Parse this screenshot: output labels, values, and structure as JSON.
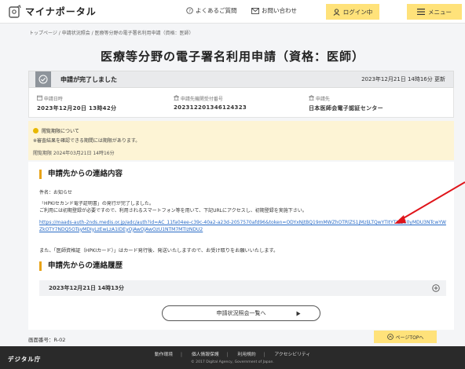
{
  "header": {
    "logo_text": "マイナポータル",
    "faq_label": "よくあるご質問",
    "contact_label": "お問い合わせ",
    "login_label": "ログイン中",
    "menu_label": "メニュー"
  },
  "breadcrumb": "トップページ / 申請状況照会 / 医療等分野の電子署名利用申請（資格：医師）",
  "page_title": "医療等分野の電子署名利用申請（資格：医師）",
  "status": {
    "message": "申請が完了しました",
    "updated": "2023年12月21日 14時16分 更新"
  },
  "info": {
    "applied_label": "申請日時",
    "applied_value": "2023年12月20日 13時42分",
    "receipt_label": "申請先機関受付番号",
    "receipt_value": "2023122013461243​23",
    "dest_label": "申請先",
    "dest_value": "日本医師会電子認証センター"
  },
  "notice": {
    "title": "閲覧期限について",
    "body": "※審査結果を確認できる期間には期限があります。",
    "deadline": "閲覧期限 2024年03月21日 14時16分"
  },
  "contact_section": {
    "title": "申請先からの連絡内容",
    "subject": "件名：お知らせ",
    "body_line1": "「HPKIセカンド電子証明書」の発行が完了しました。",
    "body_line2": "ご利用には初期登録が必要ですので、利用されるスマートフォン等を用いて、下記URLにアクセスし、初期登録を実施下さい。",
    "link": "https://maads-auth-2nds.medis.or.jp/adc/auth?id=AC_11fa04ee-c39c-40a2-a23d-2057570afd96&token=ODYxNjtBQ19mMWZhOTRlZS1jMzljLTQwYTItYTIzZC0yMDU3NTcwYWZkOTY7NDQ5OTsyMDIyLzEwLzA1IDEyOjAwOjAwOzU1NTM7MTIzNDU2",
    "note": "また、「医師資格証（HPKIカード）」はカード発行後、発送いたしますので、お受け取りをお願いいたします。"
  },
  "history_section": {
    "title": "申請先からの連絡履歴",
    "date": "2023年12月21日 14時13分",
    "back_label": "申請状況照会一覧へ"
  },
  "screen_no": "画面番号：R-02",
  "pagetop_label": "ページTOPへ",
  "footer": {
    "logo": "デジタル庁",
    "links": [
      "動作環境",
      "個人情報保護",
      "利用規約",
      "アクセシビリティ"
    ],
    "copyright": "© 2017 Digital Agency, Government of Japan."
  },
  "colors": {
    "accent_yellow": "#ffe27a",
    "section_bar": "#e8a317",
    "link_blue": "#2a6cc7",
    "annotation_arrow": "#e0141a"
  }
}
